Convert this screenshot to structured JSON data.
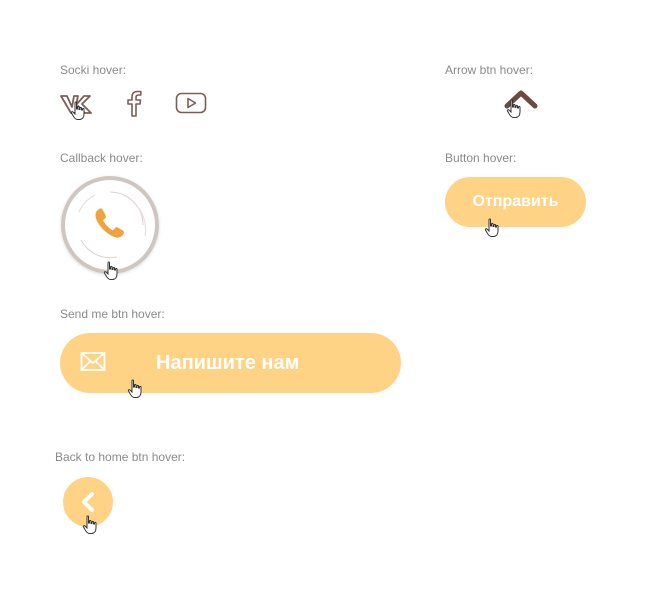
{
  "labels": {
    "socki": "Socki hover:",
    "arrow": "Arrow btn hover:",
    "callback": "Callback hover:",
    "button": "Button hover:",
    "send_me": "Send me btn hover:",
    "back_home": "Back to home btn hover:"
  },
  "social": {
    "icons": [
      "vk-icon",
      "facebook-icon",
      "youtube-icon"
    ]
  },
  "buttons": {
    "send_label": "Отправить",
    "write_label": "Напишите нам"
  },
  "colors": {
    "accent": "#ffd386",
    "icon_brown": "#7b5e55",
    "phone_orange": "#f0a23c",
    "ring_gray": "#cfc6c2",
    "label_gray": "#8a8a8a"
  }
}
